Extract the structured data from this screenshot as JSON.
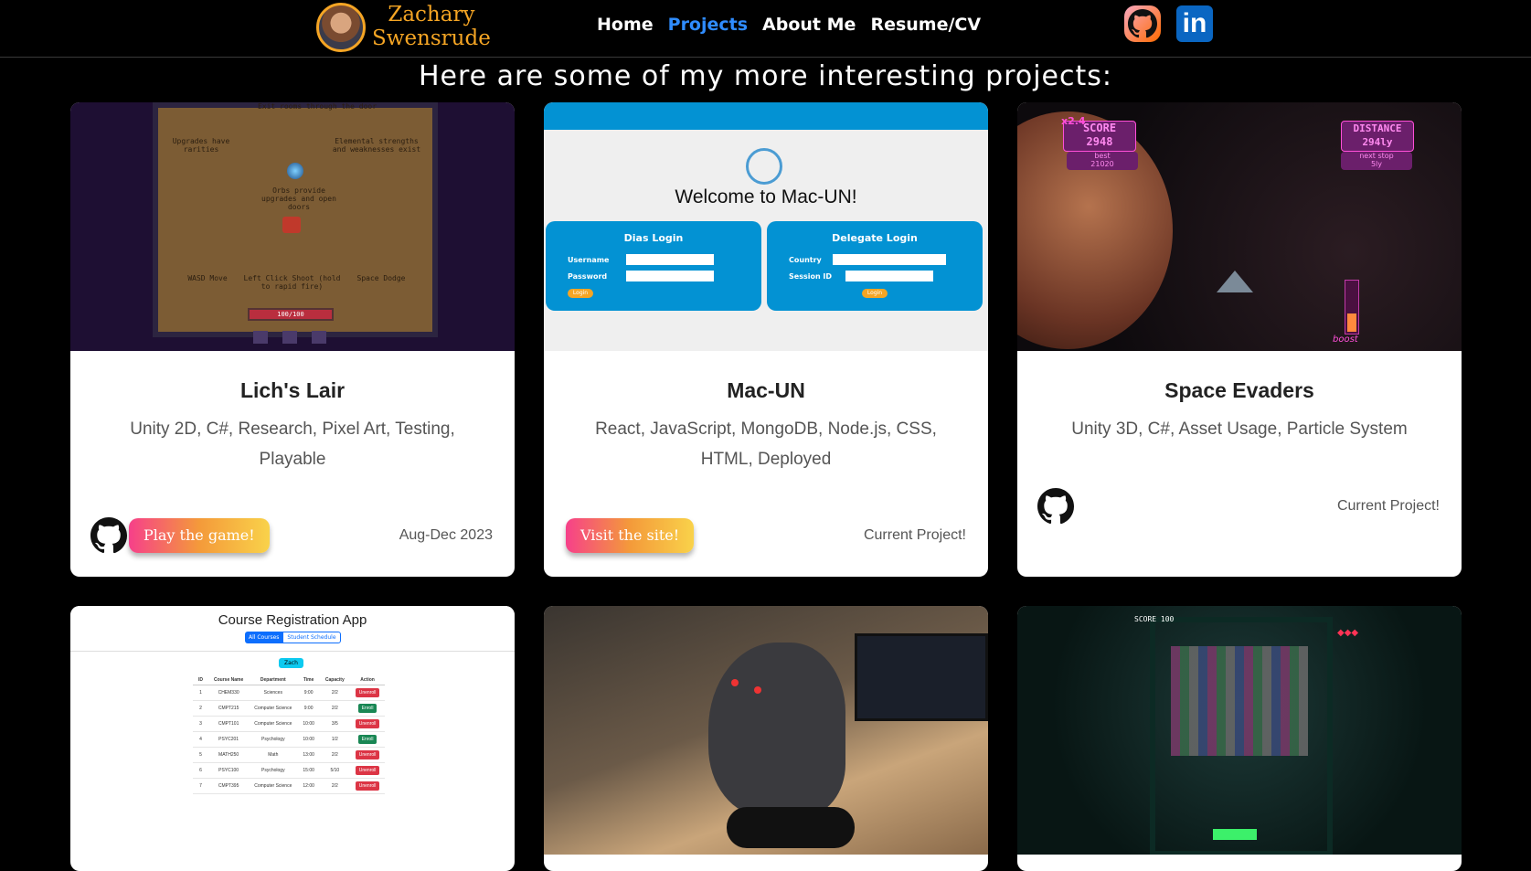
{
  "nav": {
    "brand_line1": "Zachary",
    "brand_line2": "Swensrude",
    "links": [
      "Home",
      "Projects",
      "About Me",
      "Resume/CV"
    ],
    "active_link": "Projects",
    "social": {
      "github_icon": "github-icon",
      "linkedin_label": "in"
    }
  },
  "heading": "Here are some of my more interesting projects:",
  "projects": [
    {
      "title": "Lich's Lair",
      "tags": "Unity 2D, C#, Research, Pixel Art, Testing, Playable",
      "button": "Play the game!",
      "date": "Aug-Dec 2023",
      "thumb": {
        "t1": "Exit rooms through the door",
        "t2": "Upgrades have rarities",
        "t3": "Elemental strengths and weaknesses exist",
        "t4": "Orbs provide upgrades and open doors",
        "t5": "WASD Move",
        "t6": "Left Click Shoot (hold to rapid fire)",
        "t7": "Space Dodge",
        "hp": "100/100"
      }
    },
    {
      "title": "Mac-UN",
      "tags": "React, JavaScript, MongoDB, Node.js, CSS, HTML, Deployed",
      "button": "Visit the site!",
      "date": "Current Project!",
      "thumb": {
        "welcome": "Welcome to Mac-UN!",
        "dias": "Dias Login",
        "delegate": "Delegate Login",
        "username": "Username",
        "password": "Password",
        "country": "Country",
        "session": "Session ID",
        "login": "Login"
      }
    },
    {
      "title": "Space Evaders",
      "tags": "Unity 3D, C#, Asset Usage, Particle System",
      "date": "Current Project!",
      "thumb": {
        "score_label": "SCORE",
        "score": "2948",
        "best_label": "best",
        "best": "21020",
        "mult": "x2.4",
        "dist_label": "DISTANCE",
        "dist": "294ly",
        "next_label": "next stop",
        "next": "5ly",
        "boost": "boost"
      }
    },
    {
      "thumb": {
        "title": "Course Registration App",
        "tab1": "All Courses",
        "tab2": "Student Schedule",
        "user": "Zach",
        "columns": [
          "ID",
          "Course Name",
          "Department",
          "Time",
          "Capacity",
          "Action"
        ],
        "rows": [
          [
            "1",
            "CHEM330",
            "Sciences",
            "9:00",
            "2/2",
            "Unenroll"
          ],
          [
            "2",
            "CMPT215",
            "Computer Science",
            "9:00",
            "2/2",
            "Enroll"
          ],
          [
            "3",
            "CMPT101",
            "Computer Science",
            "10:00",
            "3/5",
            "Unenroll"
          ],
          [
            "4",
            "PSYC201",
            "Psychology",
            "10:00",
            "1/2",
            "Enroll"
          ],
          [
            "5",
            "MATH250",
            "Math",
            "13:00",
            "2/2",
            "Unenroll"
          ],
          [
            "6",
            "PSYC100",
            "Psychology",
            "15:00",
            "5/10",
            "Unenroll"
          ],
          [
            "7",
            "CMPT395",
            "Computer Science",
            "12:00",
            "2/2",
            "Unenroll"
          ]
        ]
      }
    },
    {},
    {
      "thumb": {
        "score": "SCORE 100"
      }
    }
  ],
  "colors": {
    "accent": "#2f8cff",
    "brand": "#f5a524",
    "macun_blue": "#0392d3"
  }
}
